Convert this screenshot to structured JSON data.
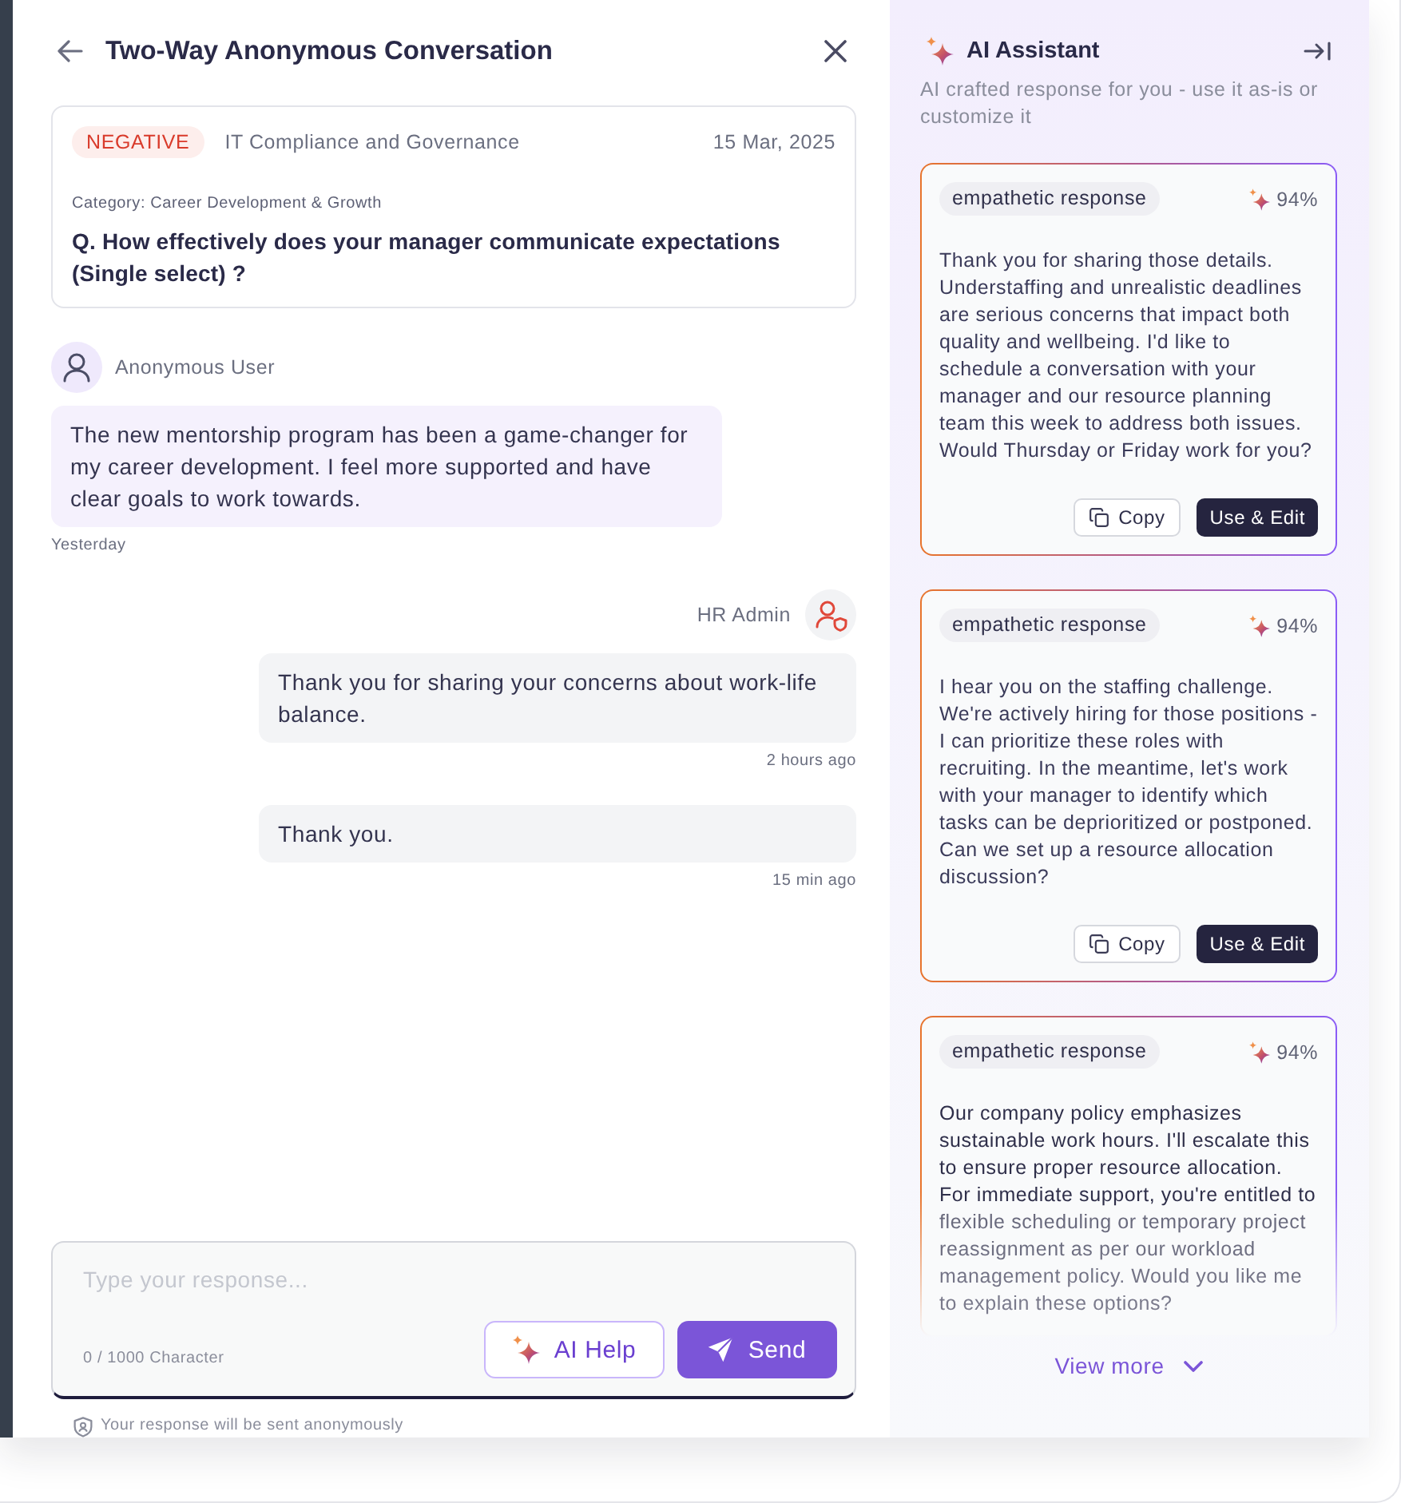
{
  "window": {
    "title": "Two-Way Anonymous Conversation"
  },
  "question_card": {
    "sentiment": {
      "label": "NEGATIVE",
      "kind": "negative"
    },
    "topic": "IT Compliance and Governance",
    "date": "15 Mar, 2025",
    "category": "Category: Career Development & Growth",
    "question": "Q. How effectively does your manager communicate expectations (Single select) ?"
  },
  "conversation": [
    {
      "kind": "employee",
      "sender": "Anonymous User",
      "messages": [
        {
          "text": "The new mentorship program has been a game-changer for my career development. I feel more supported and have clear goals to work towards.",
          "time": "Yesterday"
        }
      ]
    },
    {
      "kind": "admin",
      "sender": "HR Admin",
      "messages": [
        {
          "text": "Thank you for sharing your concerns about work-life balance.",
          "time": "2 hours ago"
        },
        {
          "text": "Thank you.",
          "time": "15 min ago"
        }
      ]
    }
  ],
  "composer": {
    "placeholder": "Type your response...",
    "counter": "0 / 1000 Character",
    "buttons": [
      {
        "label": "AI Help",
        "kind": "ai"
      },
      {
        "label": "Send",
        "kind": "send"
      }
    ],
    "note": "Your response will be sent anonymously"
  },
  "assistant": {
    "title": "AI Assistant",
    "subtitle": "AI crafted response for you - use it as-is or customize it",
    "suggestions": [
      {
        "tag": "empathetic response",
        "score": "94%",
        "text": "Thank you for sharing those details. Understaffing and unrealistic deadlines are serious concerns that impact both quality and wellbeing. I'd like to schedule a conversation with your manager and our resource planning team this week to address both issues. Would Thursday or Friday work for you?",
        "faded": false,
        "buttons": [
          {
            "label": "Copy",
            "kind": "copy"
          },
          {
            "label": "Use & Edit",
            "kind": "use"
          }
        ]
      },
      {
        "tag": "empathetic response",
        "score": "94%",
        "text": "I hear you on the staffing challenge. We're actively hiring for those positions - I can prioritize these roles with recruiting. In the meantime, let's work with your manager to identify which tasks can be deprioritized or postponed. Can we set up a resource allocation discussion?",
        "faded": false,
        "buttons": [
          {
            "label": "Copy",
            "kind": "copy"
          },
          {
            "label": "Use & Edit",
            "kind": "use"
          }
        ]
      },
      {
        "tag": "empathetic response",
        "score": "94%",
        "text": "Our company policy emphasizes sustainable work hours. I'll escalate this to ensure proper resource allocation. For immediate support, you're entitled to flexible scheduling or temporary project reassignment as per our workload management policy. Would you like me to explain these options?",
        "faded": true
      }
    ],
    "view_more": "View more"
  }
}
